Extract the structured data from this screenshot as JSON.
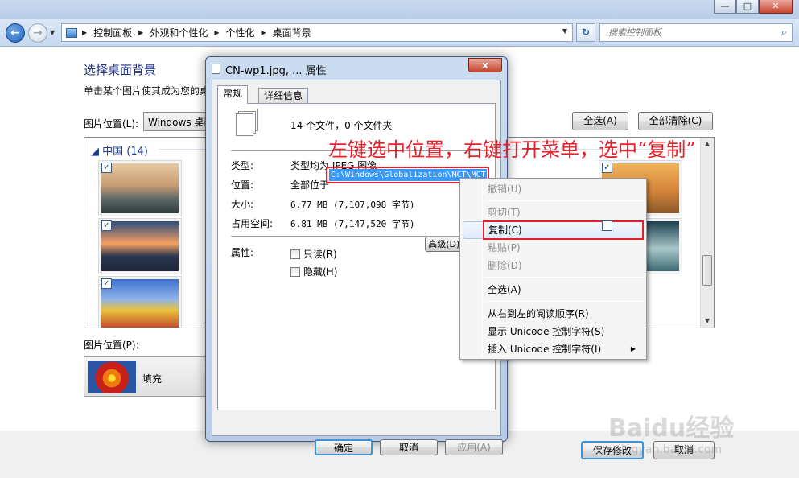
{
  "window": {
    "minimize": "—",
    "maximize": "□",
    "close": "✕"
  },
  "nav": {
    "back": "←",
    "forward": "→",
    "dropdown": "▼"
  },
  "breadcrumbs": [
    "控制面板",
    "外观和个性化",
    "个性化",
    "桌面背景"
  ],
  "search": {
    "placeholder": "搜索控制面板"
  },
  "page": {
    "title": "选择桌面背景",
    "description": "单击某个图片使其成为您的桌",
    "picture_location_label": "图片位置(L):",
    "picture_location_value": "Windows 桌面",
    "select_all": "全选(A)",
    "clear_all": "全部清除(C)",
    "group_label": "中国 (14)",
    "group_toggle": "◢",
    "position_label": "图片位置(P):",
    "position_value": "填充",
    "save": "保存修改",
    "cancel": "取消"
  },
  "thumbnails": [
    {
      "checked": "✓",
      "colors": [
        "#e6c9a0",
        "#5f6b68"
      ]
    },
    {
      "checked": "✓",
      "colors": [
        "#f7a060",
        "#2e4d7d"
      ]
    },
    {
      "checked": "✓",
      "colors": [
        "#3d6fd0",
        "#e9c23a"
      ]
    },
    {
      "checked": "✓",
      "colors": [
        "#2c62b5",
        "#d7e8f6"
      ]
    },
    {
      "checked": "✓",
      "colors": [
        "#f2b35a",
        "#8a5a2a"
      ]
    },
    {
      "checked": "",
      "colors": [
        "#1e4150",
        "#a9c7c9"
      ]
    }
  ],
  "dialog": {
    "title": "CN-wp1.jpg, ... 属性",
    "close": "x",
    "tabs": [
      "常规",
      "详细信息"
    ],
    "count": "14 个文件，0 个文件夹",
    "type_label": "类型:",
    "type_value": "类型均为 JPEG 图像",
    "location_label": "位置:",
    "location_prefix": "全部位于",
    "location_path": "C:\\Windows\\Globalization\\MCT\\MCT",
    "size_label": "大小:",
    "size_value": "6.77 MB (7,107,098 字节)",
    "disk_label": "占用空间:",
    "disk_value": "6.81 MB (7,147,520 字节)",
    "attr_label": "属性:",
    "readonly": "只读(R)",
    "hidden": "隐藏(H)",
    "advanced": "高级(D)...",
    "ok": "确定",
    "cancel": "取消",
    "apply": "应用(A)"
  },
  "context_menu": {
    "undo": "撤销(U)",
    "cut": "剪切(T)",
    "copy": "复制(C)",
    "paste": "粘贴(P)",
    "delete": "删除(D)",
    "select_all": "全选(A)",
    "rtl": "从右到左的阅读顺序(R)",
    "show_unicode": "显示 Unicode 控制字符(S)",
    "insert_unicode": "插入 Unicode 控制字符(I)",
    "submenu_arrow": "▶"
  },
  "annotation": "左键选中位置，右键打开菜单，选中“复制”",
  "watermark": {
    "brand": "Baidu经验",
    "url": "jingyan.baidu.com"
  },
  "colors": {
    "accent_red": "#e6202a",
    "selection_blue": "#3399ff",
    "title_blue": "#1e3287"
  }
}
